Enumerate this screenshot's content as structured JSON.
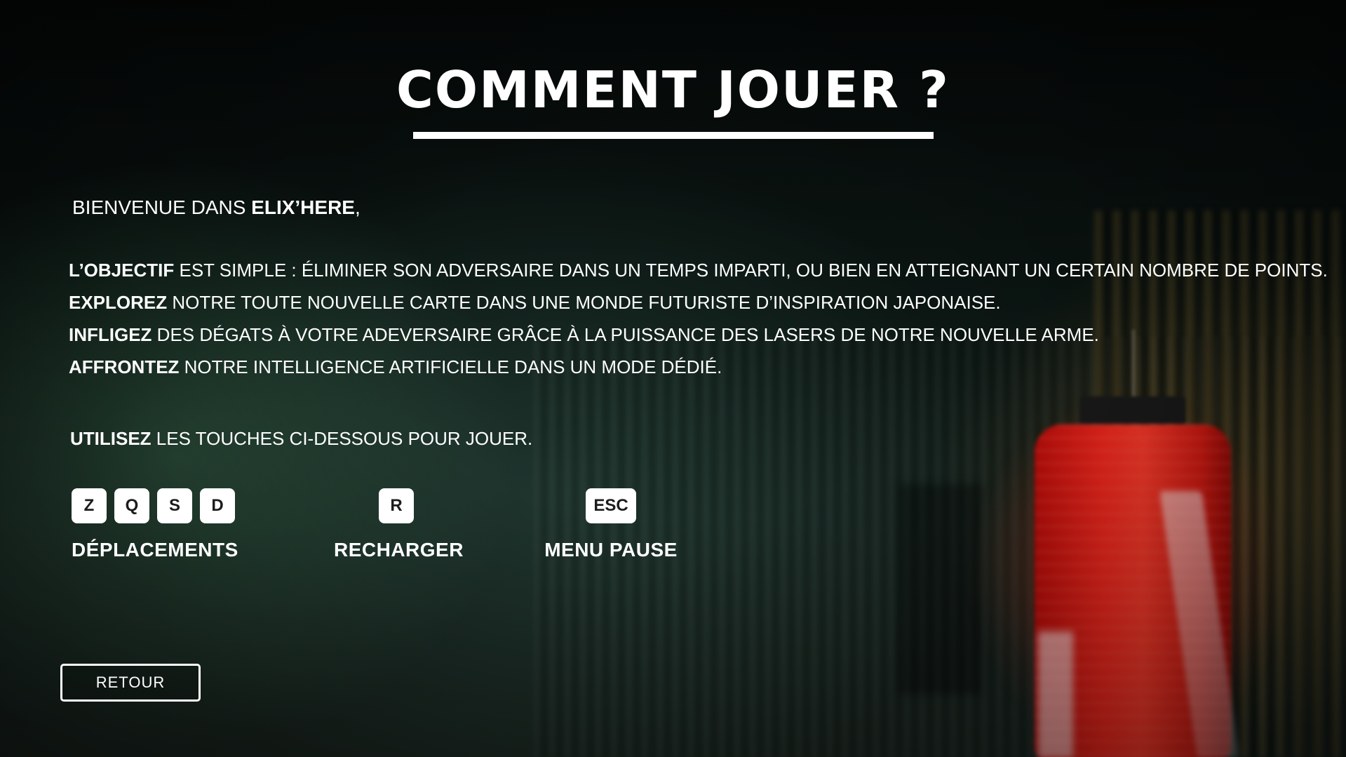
{
  "screen": {
    "title": "COMMENT JOUER ?"
  },
  "intro": {
    "welcome_prefix": "BIENVENUE DANS ",
    "game_name": "ELIX’HERE",
    "welcome_suffix": ","
  },
  "objectives": [
    {
      "keyword": "L’OBJECTIF",
      "text": " EST SIMPLE : ÉLIMINER SON ADVERSAIRE DANS UN TEMPS IMPARTI, OU BIEN EN ATTEIGNANT UN CERTAIN NOMBRE DE POINTS."
    },
    {
      "keyword": "EXPLOREZ",
      "text": " NOTRE TOUTE NOUVELLE CARTE DANS UNE MONDE FUTURISTE D’INSPIRATION JAPONAISE."
    },
    {
      "keyword": "INFLIGEZ",
      "text": " DES DÉGATS À VOTRE ADEVERSAIRE GRÂCE À LA PUISSANCE DES LASERS DE NOTRE NOUVELLE ARME."
    },
    {
      "keyword": "AFFRONTEZ",
      "text": " NOTRE INTELLIGENCE ARTIFICIELLE DANS UN MODE DÉDIÉ."
    }
  ],
  "controls_intro": {
    "keyword": "UTILISEZ",
    "text": " LES TOUCHES CI-DESSOUS POUR JOUER."
  },
  "controls": {
    "move": {
      "keys": [
        "Z",
        "Q",
        "S",
        "D"
      ],
      "label": "DÉPLACEMENTS"
    },
    "reload": {
      "keys": [
        "R"
      ],
      "label": "RECHARGER"
    },
    "pause": {
      "keys": [
        "ESC"
      ],
      "label": "MENU PAUSE"
    }
  },
  "back_button": {
    "label": "RETOUR"
  },
  "colors": {
    "text": "#ffffff",
    "key_background": "#ffffff",
    "key_text": "#1c1c1c",
    "lantern_red": "#f3271d"
  }
}
